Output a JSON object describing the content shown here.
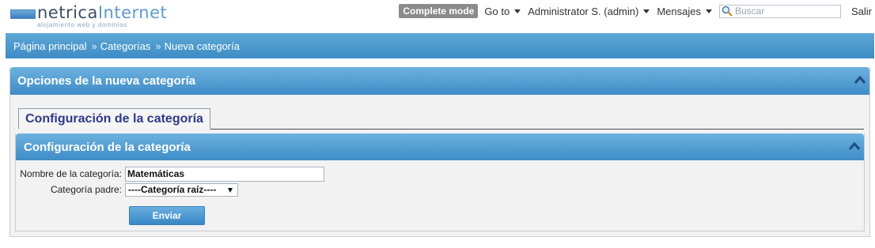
{
  "brand": {
    "name_a": "netrica",
    "name_b": "Internet",
    "tagline": "alojamiento web y dominios"
  },
  "topnav": {
    "mode_label": "Complete mode",
    "goto_label": "Go to",
    "user_label": "Administrator S. (admin)",
    "messages_label": "Mensajes",
    "search_placeholder": "Buscar",
    "logout_label": "Salir"
  },
  "breadcrumb": {
    "items": [
      "Página principal",
      "Categorías",
      "Nueva categoría"
    ],
    "separator": "»"
  },
  "panel": {
    "title": "Opciones de la nueva categoría"
  },
  "tabs": [
    {
      "label": "Configuración de la categoría"
    }
  ],
  "section": {
    "title": "Configuración de la categoría",
    "fields": {
      "name_label": "Nombre de la categoría:",
      "name_value": "Matemáticas",
      "parent_label": "Categoría padre:",
      "parent_value": "----Categoría raíz----"
    },
    "submit_label": "Enviar"
  },
  "colors": {
    "accent": "#4a96cf",
    "tab_text": "#2f3a8a",
    "mode_badge": "#8b8b8b"
  }
}
